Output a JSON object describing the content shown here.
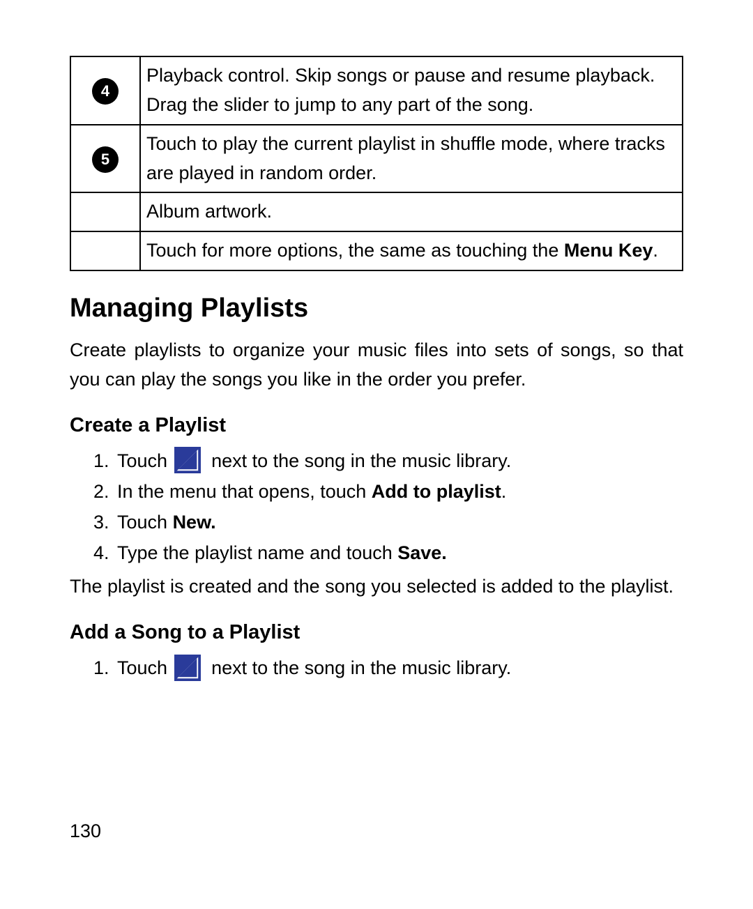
{
  "table": {
    "rows": [
      {
        "num": "4",
        "text": "Playback control. Skip songs or pause and resume playback. Drag the slider to jump to any part of the song."
      },
      {
        "num": "5",
        "text": "Touch to play the current playlist in shuffle mode, where tracks are played in random order."
      },
      {
        "num": "",
        "text": "Album artwork."
      },
      {
        "num": "",
        "text_pre": "Touch for more options, the same as touching the ",
        "bold": "Menu Key",
        "text_post": "."
      }
    ]
  },
  "heading": "Managing Playlists",
  "intro": "Create playlists to organize your music files into sets of songs, so that you can play the songs you like in the order you prefer.",
  "sub1": "Create a Playlist",
  "steps1": {
    "s1_pre": "Touch ",
    "s1_post": " next to the song in the music library.",
    "s2_pre": "In the menu that opens, touch ",
    "s2_bold": "Add to playlist",
    "s2_post": ".",
    "s3_pre": "Touch ",
    "s3_bold": "New.",
    "s4_pre": "Type the playlist name and touch ",
    "s4_bold": "Save."
  },
  "after_steps1": "The playlist is created and the song you selected is added to the playlist.",
  "sub2": "Add a Song to a Playlist",
  "steps2": {
    "s1_pre": "Touch ",
    "s1_post": " next to the song in the music library."
  },
  "page_number": "130",
  "icons": {
    "arrow_label": "arrow-icon"
  }
}
